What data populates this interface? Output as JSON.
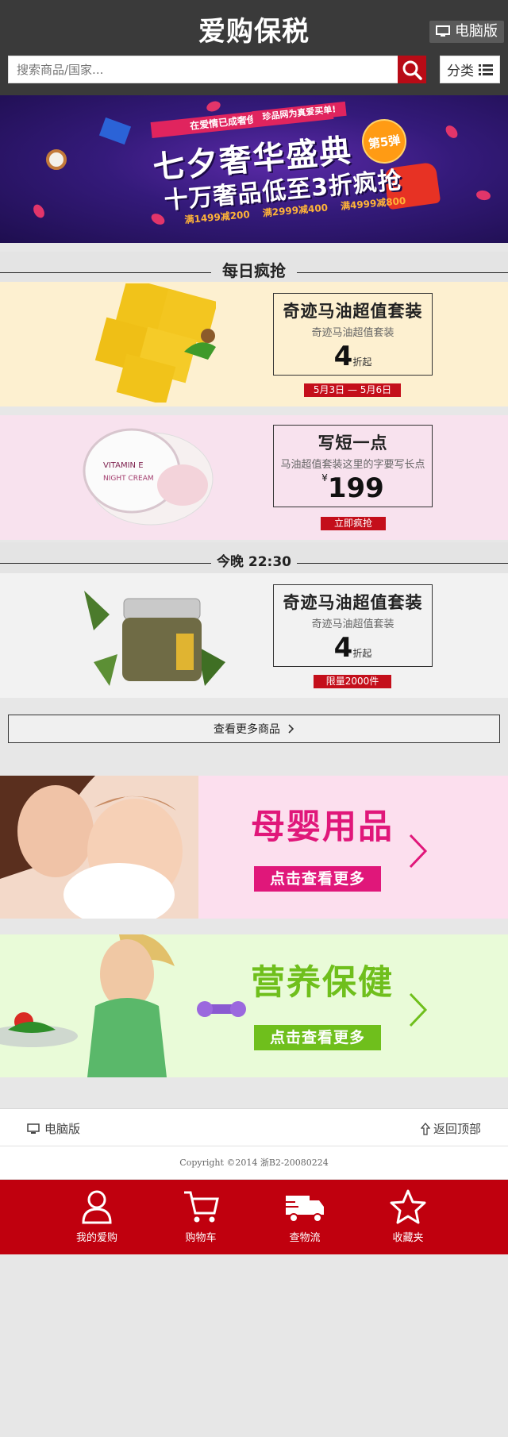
{
  "header": {
    "logo": "爱购保税",
    "pc_link": "电脑版",
    "search_placeholder": "搜索商品/国家...",
    "category_label": "分类"
  },
  "hero": {
    "ribbon_main": "在爱情已成奢侈品的年代",
    "ribbon_side": "珍品网为真爱买单!",
    "title_line1": "七夕奢华盛典",
    "title_line2": "十万奢品低至3折疯抢",
    "badge": "第5弹",
    "deals": [
      "满1499减200",
      "满2999减400",
      "满4999减800"
    ]
  },
  "sections": {
    "daily": "每日疯抢",
    "tonight": "今晚 22:30"
  },
  "promos": [
    {
      "title": "奇迹马油超值套装",
      "subtitle": "奇迹马油超值套装",
      "value": "4",
      "unit": "折起",
      "tag": "5月3日 — 5月6日"
    },
    {
      "title": "写短一点",
      "subtitle": "马油超值套装这里的字要写长点",
      "currency": "¥",
      "value": "199",
      "tag": "立即疯抢"
    },
    {
      "title": "奇迹马油超值套装",
      "subtitle": "奇迹马油超值套装",
      "value": "4",
      "unit": "折起",
      "tag": "限量2000件"
    }
  ],
  "more_button": "查看更多商品",
  "categories": [
    {
      "title": "母婴用品",
      "button": "点击查看更多",
      "color": "#e0177a"
    },
    {
      "title": "营养保健",
      "button": "点击查看更多",
      "color": "#6fbf1c"
    }
  ],
  "footer": {
    "pc_version": "电脑版",
    "back_to_top": "返回顶部",
    "copyright": "Copyright ©2014 浙B2-20080224"
  },
  "bottom_nav": [
    {
      "label": "我的爱购",
      "icon": "user-icon"
    },
    {
      "label": "购物车",
      "icon": "cart-icon"
    },
    {
      "label": "查物流",
      "icon": "truck-icon"
    },
    {
      "label": "收藏夹",
      "icon": "star-icon"
    }
  ],
  "colors": {
    "header_bg": "#3a3a3a",
    "accent_red": "#c0000e",
    "search_button": "#b80b16"
  }
}
